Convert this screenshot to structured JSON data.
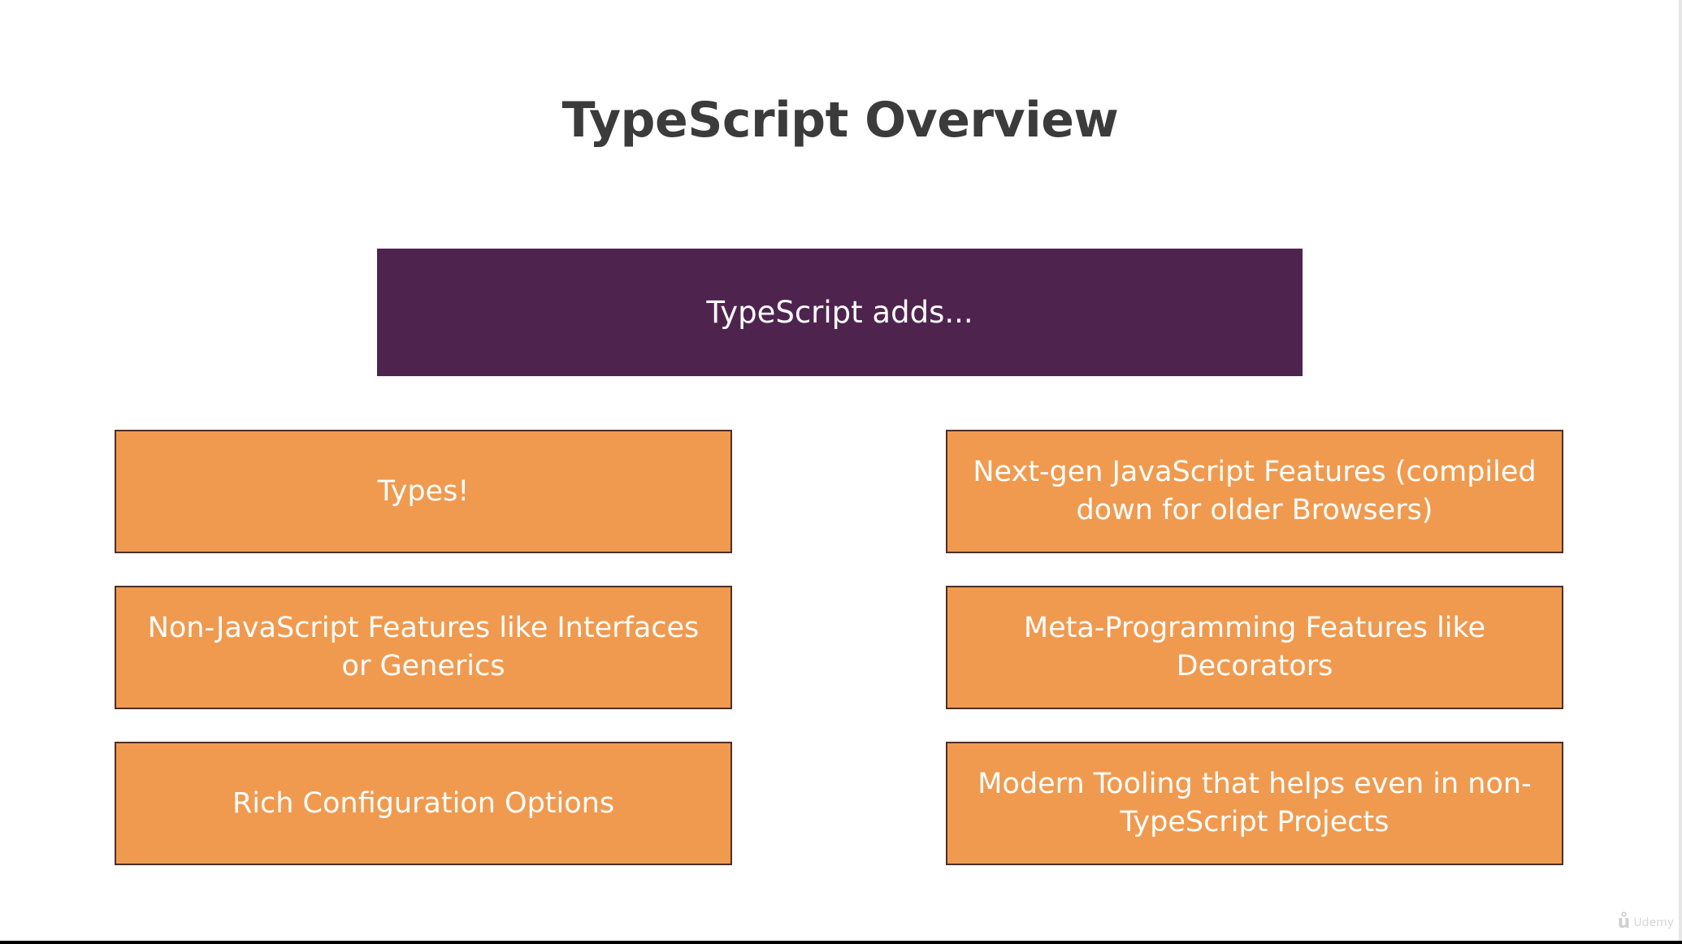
{
  "slide": {
    "title": "TypeScript Overview",
    "header": "TypeScript adds...",
    "features": [
      "Types!",
      "Next-gen JavaScript Features (compiled down for older Browsers)",
      "Non-JavaScript Features like Interfaces or Generics",
      "Meta-Programming Features like Decorators",
      "Rich Configuration Options",
      "Modern Tooling that helps even in non-TypeScript Projects"
    ]
  },
  "watermark": {
    "icon": "udemy-logo-icon",
    "text": "Udemy"
  },
  "colors": {
    "header_bg": "#4e244e",
    "card_bg": "#f09a4f",
    "card_border": "#4e2e2a",
    "title": "#3b3b3b",
    "background": "#ffffff"
  }
}
